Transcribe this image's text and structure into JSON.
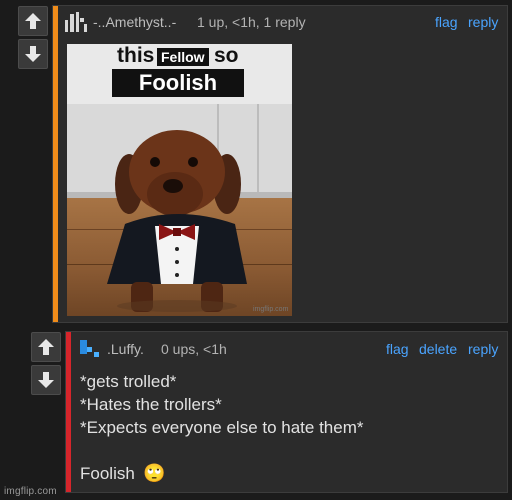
{
  "colors": {
    "bg": "#1b1b1b",
    "panel": "#2b2b2b",
    "link": "#4aa4ff",
    "bar_first": "#f08c1a",
    "bar_second": "#d6252b",
    "vote_bg": "#3a3a3a"
  },
  "comments": [
    {
      "username": "-..Amethyst..-",
      "meta": "1 up, <1h, 1 reply",
      "actions": {
        "flag": "flag",
        "reply": "reply"
      },
      "avatar_icon": "pixel-pillar-icon",
      "meme": {
        "top_word_left": "this",
        "caption_box": "Fellow",
        "top_word_right": "so",
        "bottom_caption": "Foolish",
        "image_watermark": "imgflip.com"
      }
    },
    {
      "username": ".Luffy.",
      "meta": "0 ups, <1h",
      "actions": {
        "flag": "flag",
        "delete": "delete",
        "reply": "reply"
      },
      "avatar_icon": "pixel-blocks-icon",
      "lines": [
        "*gets trolled*",
        "*Hates the trollers*",
        "*Expects everyone else to hate them*",
        "",
        "Foolish"
      ],
      "emoji": "🙄"
    }
  ],
  "footer": {
    "watermark": "imgflip.com"
  }
}
